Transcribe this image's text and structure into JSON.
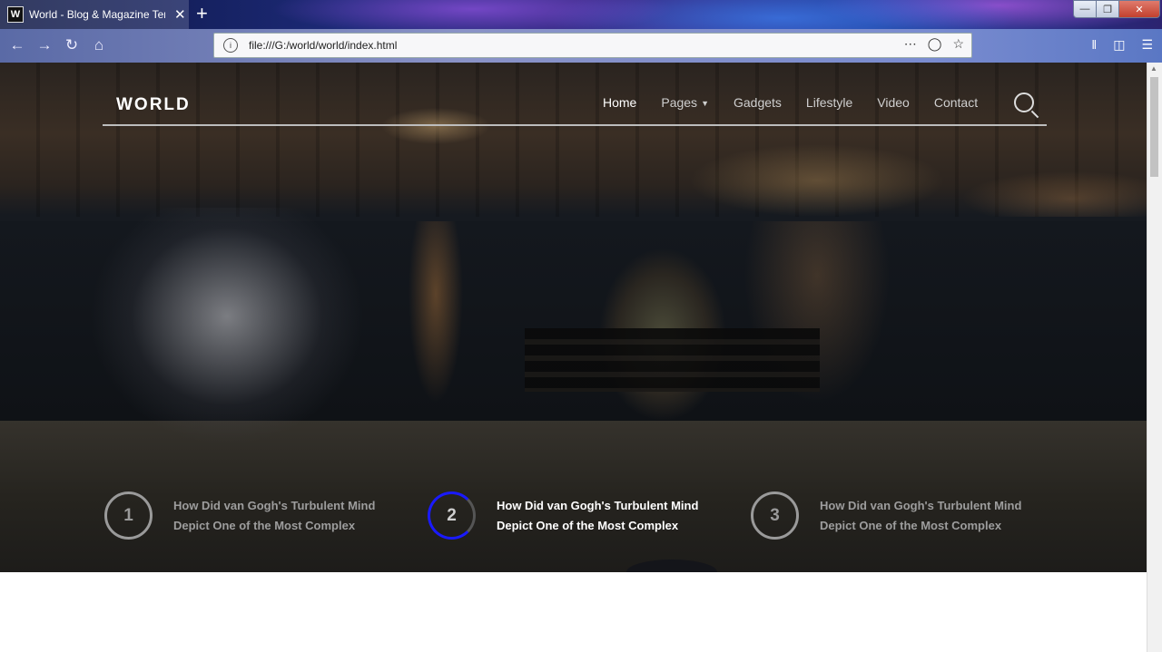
{
  "browser": {
    "tab_favicon": "W",
    "tab_title": "World - Blog & Magazine Tem",
    "tab_close": "✕",
    "new_tab": "+",
    "url": "file:///G:/world/world/index.html",
    "nav_icons": [
      "back-icon",
      "forward-icon",
      "reload-icon",
      "home-icon"
    ],
    "url_action_icons": [
      "page-actions-icon",
      "pocket-icon",
      "bookmark-star-icon"
    ],
    "right_icons": [
      "library-icon",
      "sidebar-icon",
      "menu-icon"
    ]
  },
  "site": {
    "logo": "WORLD",
    "menu": [
      {
        "label": "Home",
        "active": true
      },
      {
        "label": "Pages",
        "dropdown": true
      },
      {
        "label": "Gadgets"
      },
      {
        "label": "Lifestyle"
      },
      {
        "label": "Video"
      },
      {
        "label": "Contact"
      }
    ],
    "slides": [
      {
        "number": "1",
        "line1": "How Did van Gogh's Turbulent Mind",
        "line2": "Depict One of the Most Complex"
      },
      {
        "number": "2",
        "line1": "How Did van Gogh's Turbulent Mind",
        "line2": "Depict One of the Most Complex",
        "active": true
      },
      {
        "number": "3",
        "line1": "How Did van Gogh's Turbulent Mind",
        "line2": "Depict One of the Most Complex"
      }
    ]
  },
  "colors": {
    "active_ring": "#1a1aff",
    "inactive_ring": "#9a9a9a",
    "menu_text": "#cfcfcf",
    "menu_active": "#ffffff"
  }
}
